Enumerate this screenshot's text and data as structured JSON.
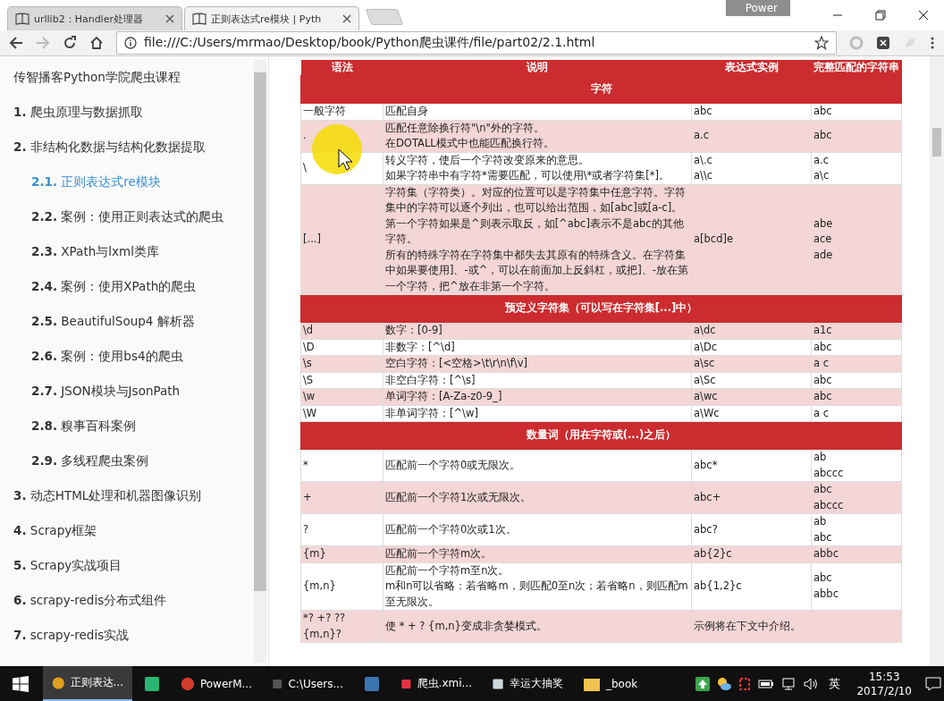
{
  "browser": {
    "tabs": [
      {
        "title": "urllib2：Handler处理器",
        "selected": false
      },
      {
        "title": "正则表达式re模块 | Pyth",
        "selected": true
      }
    ],
    "badge": "Power",
    "url": "file:///C:/Users/mrmao/Desktop/book/Python爬虫课件/file/part02/2.1.html"
  },
  "sidebar": {
    "title": "传智播客Python学院爬虫课程",
    "items": [
      {
        "num": "1.",
        "label": "爬虫原理与数据抓取",
        "selected": false
      },
      {
        "num": "2.",
        "label": "非结构化数据与结构化数据提取",
        "selected": false,
        "children": [
          {
            "num": "2.1.",
            "label": "正则表达式re模块",
            "selected": true
          },
          {
            "num": "2.2.",
            "label": "案例：使用正则表达式的爬虫",
            "selected": false
          },
          {
            "num": "2.3.",
            "label": "XPath与lxml类库",
            "selected": false
          },
          {
            "num": "2.4.",
            "label": "案例：使用XPath的爬虫",
            "selected": false
          },
          {
            "num": "2.5.",
            "label": "BeautifulSoup4 解析器",
            "selected": false
          },
          {
            "num": "2.6.",
            "label": "案例：使用bs4的爬虫",
            "selected": false
          },
          {
            "num": "2.7.",
            "label": "JSON模块与JsonPath",
            "selected": false
          },
          {
            "num": "2.8.",
            "label": "糗事百科案例",
            "selected": false
          },
          {
            "num": "2.9.",
            "label": "多线程爬虫案例",
            "selected": false
          }
        ]
      },
      {
        "num": "3.",
        "label": "动态HTML处理和机器图像识别",
        "selected": false
      },
      {
        "num": "4.",
        "label": "Scrapy框架",
        "selected": false
      },
      {
        "num": "5.",
        "label": "Scrapy实战项目",
        "selected": false
      },
      {
        "num": "6.",
        "label": "scrapy-redis分布式组件",
        "selected": false
      },
      {
        "num": "7.",
        "label": "scrapy-redis实战",
        "selected": false
      }
    ]
  },
  "table": {
    "columns": [
      "语法",
      "说明",
      "表达式实例",
      "完整匹配的字符串"
    ],
    "rows": [
      {
        "kind": "section",
        "title": "字符"
      },
      {
        "kind": "row",
        "syntax": [
          "一般字符"
        ],
        "desc": [
          "匹配自身"
        ],
        "example": [
          "abc"
        ],
        "match": [
          "abc"
        ]
      },
      {
        "kind": "row",
        "syntax": [
          "."
        ],
        "desc": [
          "匹配任意除换行符\"\\n\"外的字符。",
          "在DOTALL模式中也能匹配换行符。"
        ],
        "example": [
          "a.c"
        ],
        "match": [
          "abc"
        ]
      },
      {
        "kind": "row",
        "syntax": [
          "\\"
        ],
        "desc": [
          "转义字符，使后一个字符改变原来的意思。",
          "如果字符串中有字符*需要匹配，可以使用\\*或者字符集[*]。"
        ],
        "example": [
          "a\\.c",
          "a\\\\c"
        ],
        "match": [
          "a.c",
          "a\\c"
        ]
      },
      {
        "kind": "row",
        "syntax": [
          "[...]"
        ],
        "desc": [
          "字符集（字符类）。对应的位置可以是字符集中任意字符。字符集中的字符可以逐个列出，也可以给出范围，如[abc]或[a-c]。第一个字符如果是^则表示取反，如[^abc]表示不是abc的其他字符。",
          "所有的特殊字符在字符集中都失去其原有的特殊含义。在字符集中如果要使用]、-或^，可以在前面加上反斜杠，或把]、-放在第一个字符，把^放在非第一个字符。"
        ],
        "example": [
          "a[bcd]e"
        ],
        "match": [
          "abe",
          "ace",
          "ade"
        ]
      },
      {
        "kind": "section",
        "title": "预定义字符集（可以写在字符集[...]中）"
      },
      {
        "kind": "row",
        "syntax": [
          "\\d"
        ],
        "desc": [
          "数字：[0-9]"
        ],
        "example": [
          "a\\dc"
        ],
        "match": [
          "a1c"
        ]
      },
      {
        "kind": "row",
        "syntax": [
          "\\D"
        ],
        "desc": [
          "非数字：[^\\d]"
        ],
        "example": [
          "a\\Dc"
        ],
        "match": [
          "abc"
        ]
      },
      {
        "kind": "row",
        "syntax": [
          "\\s"
        ],
        "desc": [
          "空白字符：[<空格>\\t\\r\\n\\f\\v]"
        ],
        "example": [
          "a\\sc"
        ],
        "match": [
          "a c"
        ]
      },
      {
        "kind": "row",
        "syntax": [
          "\\S"
        ],
        "desc": [
          "非空白字符：[^\\s]"
        ],
        "example": [
          "a\\Sc"
        ],
        "match": [
          "abc"
        ]
      },
      {
        "kind": "row",
        "syntax": [
          "\\w"
        ],
        "desc": [
          "单词字符：[A-Za-z0-9_]"
        ],
        "example": [
          "a\\wc"
        ],
        "match": [
          "abc"
        ]
      },
      {
        "kind": "row",
        "syntax": [
          "\\W"
        ],
        "desc": [
          "非单词字符：[^\\w]"
        ],
        "example": [
          "a\\Wc"
        ],
        "match": [
          "a c"
        ]
      },
      {
        "kind": "section",
        "title": "数量词（用在字符或(...)之后）"
      },
      {
        "kind": "row",
        "syntax": [
          "*"
        ],
        "desc": [
          "匹配前一个字符0或无限次。"
        ],
        "example": [
          "abc*"
        ],
        "match": [
          "ab",
          "abccc"
        ]
      },
      {
        "kind": "row",
        "syntax": [
          "+"
        ],
        "desc": [
          "匹配前一个字符1次或无限次。"
        ],
        "example": [
          "abc+"
        ],
        "match": [
          "abc",
          "abccc"
        ]
      },
      {
        "kind": "row",
        "syntax": [
          "?"
        ],
        "desc": [
          "匹配前一个字符0次或1次。"
        ],
        "example": [
          "abc?"
        ],
        "match": [
          "ab",
          "abc"
        ]
      },
      {
        "kind": "row",
        "syntax": [
          "{m}"
        ],
        "desc": [
          "匹配前一个字符m次。"
        ],
        "example": [
          "ab{2}c"
        ],
        "match": [
          "abbc"
        ]
      },
      {
        "kind": "row",
        "syntax": [
          "{m,n}"
        ],
        "desc": [
          "匹配前一个字符m至n次。",
          "m和n可以省略：若省略m，则匹配0至n次；若省略n，则匹配m至无限次。"
        ],
        "example": [
          "ab{1,2}c"
        ],
        "match": [
          "abc",
          "abbc"
        ]
      },
      {
        "kind": "row",
        "syntax": [
          "*? +? ??",
          "{m,n}?"
        ],
        "desc": [
          "使 * + ? {m,n}变成非贪婪模式。"
        ],
        "example": [
          "示例将在下文中介绍。"
        ],
        "match": []
      }
    ]
  },
  "taskbar": {
    "items": [
      {
        "label": "正则表达...",
        "selected": true
      },
      {
        "selected": false
      },
      {
        "label": "PowerM...",
        "selected": false
      },
      {
        "label": "C:\\Users...",
        "selected": false
      },
      {
        "selected": false
      },
      {
        "label": "爬虫.xmi...",
        "selected": false
      },
      {
        "label": "幸运大抽奖",
        "selected": false
      },
      {
        "label": "_book",
        "selected": false
      }
    ],
    "ime": "英",
    "time": "15:53",
    "date": "2017/2/10"
  }
}
